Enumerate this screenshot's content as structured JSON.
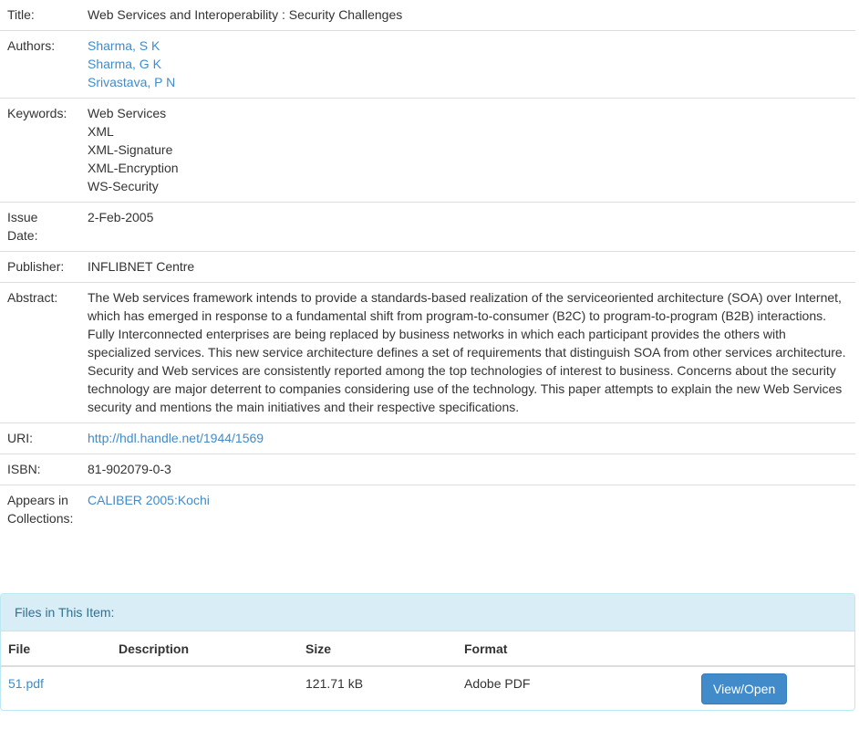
{
  "metadata": {
    "title_label": "Title:",
    "title": "Web Services and Interoperability : Security Challenges",
    "authors_label": "Authors:",
    "authors": [
      "Sharma, S K",
      "Sharma, G K",
      "Srivastava, P N"
    ],
    "keywords_label": "Keywords:",
    "keywords": [
      "Web Services",
      "XML",
      "XML-Signature",
      "XML-Encryption",
      "WS-Security"
    ],
    "issue_date_label_line1": "Issue",
    "issue_date_label_line2": "Date:",
    "issue_date": "2-Feb-2005",
    "publisher_label": "Publisher:",
    "publisher": "INFLIBNET Centre",
    "abstract_label": "Abstract:",
    "abstract": "The Web services framework intends to provide a standards-based realization of the serviceoriented architecture (SOA) over Internet, which has emerged in response to a fundamental shift from program-to-consumer (B2C) to program-to-program (B2B) interactions. Fully Interconnected enterprises are being replaced by business networks in which each participant provides the others with specialized services. This new service architecture defines a set of requirements that distinguish SOA from other services architecture. Security and Web services are consistently reported among the top technologies of interest to business. Concerns about the security technology are major deterrent to companies considering use of the technology. This paper attempts to explain the new Web Services security and mentions the main initiatives and their respective specifications.",
    "uri_label": "URI:",
    "uri": "http://hdl.handle.net/1944/1569",
    "isbn_label": "ISBN:",
    "isbn": "81-902079-0-3",
    "collections_label_line1": "Appears in",
    "collections_label_line2": "Collections:",
    "collection": "CALIBER 2005:Kochi"
  },
  "files": {
    "heading": "Files in This Item:",
    "columns": [
      "File",
      "Description",
      "Size",
      "Format"
    ],
    "rows": [
      {
        "file": "51.pdf",
        "description": "",
        "size": "121.71 kB",
        "format": "Adobe PDF",
        "action": "View/Open"
      }
    ]
  },
  "colors": {
    "link": "#428bca",
    "panel_heading_bg": "#d9edf7",
    "panel_heading_text": "#31708f",
    "button_bg": "#428bca"
  }
}
